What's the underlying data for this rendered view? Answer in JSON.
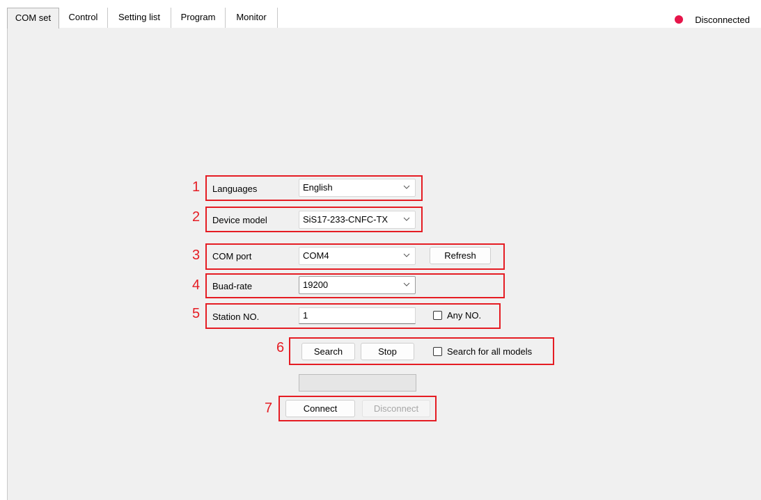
{
  "tabs": [
    "COM set",
    "Control",
    "Setting list",
    "Program",
    "Monitor"
  ],
  "status": {
    "text": "Disconnected",
    "color": "#e6154a"
  },
  "callouts": [
    "1",
    "2",
    "3",
    "4",
    "5",
    "6",
    "7"
  ],
  "form": {
    "languages": {
      "label": "Languages",
      "value": "English"
    },
    "device_model": {
      "label": "Device model",
      "value": "SiS17-233-CNFC-TX"
    },
    "com_port": {
      "label": "COM port",
      "value": "COM4",
      "refresh_label": "Refresh"
    },
    "baud_rate": {
      "label": "Buad-rate",
      "value": "19200"
    },
    "station": {
      "label": "Station NO.",
      "value": "1",
      "any_label": "Any NO.",
      "any_checked": false
    },
    "search": {
      "search_label": "Search",
      "stop_label": "Stop",
      "all_models_label": "Search for all models",
      "all_models_checked": false
    },
    "connect": {
      "connect_label": "Connect",
      "disconnect_label": "Disconnect"
    }
  },
  "colors": {
    "highlight": "#e51c23",
    "panel": "#f0f0f0"
  }
}
